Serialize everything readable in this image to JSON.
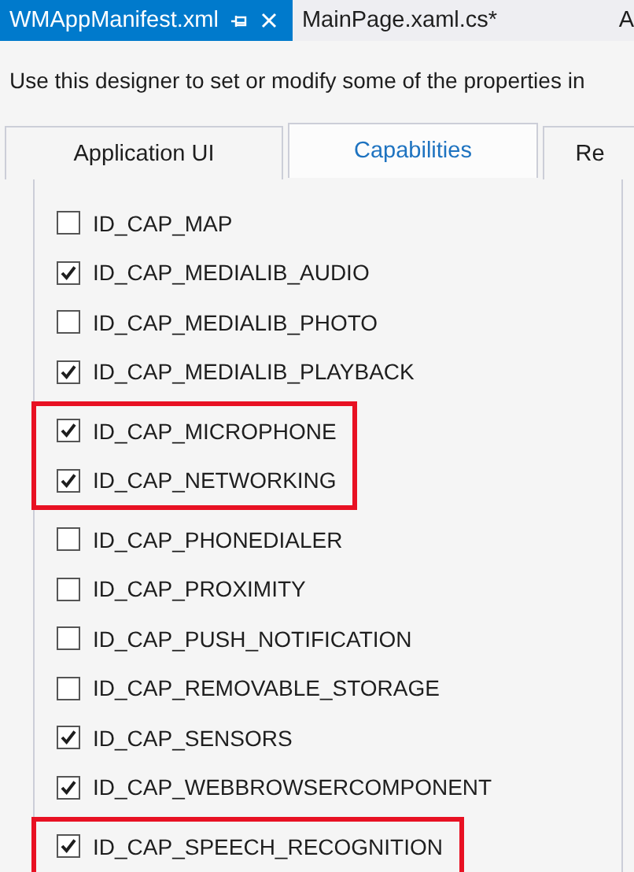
{
  "document_tabs": [
    {
      "label": "WMAppManifest.xml",
      "selected": true
    },
    {
      "label": "MainPage.xaml.cs*",
      "selected": false
    },
    {
      "label": "A",
      "selected": false
    }
  ],
  "description": "Use this designer to set or modify some of the properties in",
  "tabs": [
    {
      "label": "Application UI",
      "selected": false
    },
    {
      "label": "Capabilities",
      "selected": true
    },
    {
      "label": "Re",
      "selected": false
    }
  ],
  "capability_groups": [
    {
      "highlighted": false,
      "items": [
        {
          "label": "ID_CAP_MAP",
          "checked": false
        },
        {
          "label": "ID_CAP_MEDIALIB_AUDIO",
          "checked": true
        },
        {
          "label": "ID_CAP_MEDIALIB_PHOTO",
          "checked": false
        },
        {
          "label": "ID_CAP_MEDIALIB_PLAYBACK",
          "checked": true
        }
      ]
    },
    {
      "highlighted": true,
      "items": [
        {
          "label": "ID_CAP_MICROPHONE",
          "checked": true
        },
        {
          "label": "ID_CAP_NETWORKING",
          "checked": true
        }
      ]
    },
    {
      "highlighted": false,
      "items": [
        {
          "label": "ID_CAP_PHONEDIALER",
          "checked": false
        },
        {
          "label": "ID_CAP_PROXIMITY",
          "checked": false
        },
        {
          "label": "ID_CAP_PUSH_NOTIFICATION",
          "checked": false
        },
        {
          "label": "ID_CAP_REMOVABLE_STORAGE",
          "checked": false
        },
        {
          "label": "ID_CAP_SENSORS",
          "checked": true
        },
        {
          "label": "ID_CAP_WEBBROWSERCOMPONENT",
          "checked": true
        }
      ]
    },
    {
      "highlighted": true,
      "items": [
        {
          "label": "ID_CAP_SPEECH_RECOGNITION",
          "checked": true
        }
      ]
    }
  ]
}
